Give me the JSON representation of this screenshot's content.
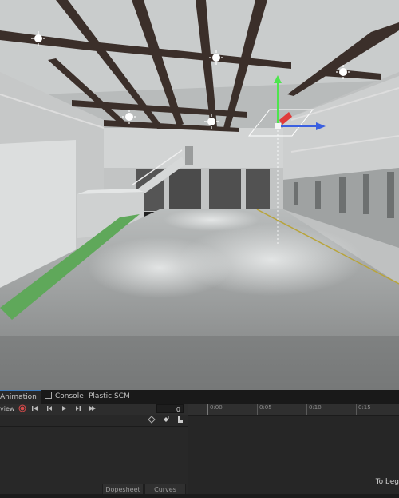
{
  "panel": {
    "tabs": [
      {
        "label": "Animation"
      },
      {
        "label": "Console"
      },
      {
        "label": "Plastic SCM"
      }
    ],
    "toolbar": {
      "preview_label": "view",
      "frame_value": "0"
    },
    "timeline": {
      "ticks": [
        "0:00",
        "0:05",
        "0:10",
        "0:15"
      ]
    },
    "empty_hint": "To beg",
    "bottom_tabs": [
      {
        "label": "Dopesheet"
      },
      {
        "label": "Curves"
      }
    ]
  },
  "icons": [
    "record-icon",
    "first-key-icon",
    "prev-key-icon",
    "play-icon",
    "next-key-icon",
    "last-key-icon",
    "add-keyframe-icon",
    "add-event-icon",
    "filter-icon",
    "point-light-icon",
    "move-gizmo-icon"
  ],
  "colors": {
    "record": "#d84a4a",
    "gizmo_y": "#4ee54e",
    "gizmo_x": "#3a5fe0",
    "gizmo_z": "#e03a3a",
    "floor_stripe": "#5fa85a"
  }
}
